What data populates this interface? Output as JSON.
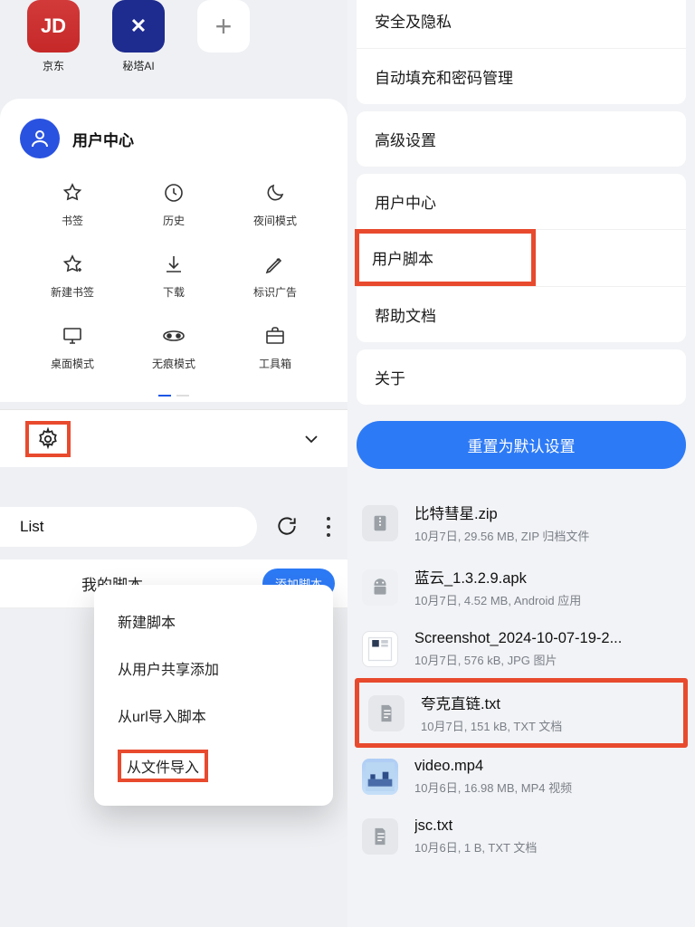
{
  "home": {
    "apps": [
      {
        "id": "jd",
        "label": "京东",
        "tile": "JD"
      },
      {
        "id": "mita",
        "label": "秘塔AI",
        "tile": "✕"
      },
      {
        "id": "plus",
        "label": "",
        "tile": "+"
      }
    ]
  },
  "user_center": {
    "title": "用户中心",
    "grid": [
      {
        "id": "bookmark",
        "label": "书签"
      },
      {
        "id": "history",
        "label": "历史"
      },
      {
        "id": "night",
        "label": "夜间模式"
      },
      {
        "id": "add-bookmark",
        "label": "新建书签"
      },
      {
        "id": "download",
        "label": "下载"
      },
      {
        "id": "mark-ad",
        "label": "标识广告"
      },
      {
        "id": "desktop",
        "label": "桌面模式"
      },
      {
        "id": "incognito",
        "label": "无痕模式"
      },
      {
        "id": "toolbox",
        "label": "工具箱"
      }
    ]
  },
  "address_bar": {
    "text": "List"
  },
  "scripts": {
    "my_scripts_label": "我的脚本",
    "add_label": "添加脚本",
    "menu": [
      {
        "id": "new",
        "label": "新建脚本"
      },
      {
        "id": "from-share",
        "label": "从用户共享添加"
      },
      {
        "id": "from-url",
        "label": "从url导入脚本"
      },
      {
        "id": "from-file",
        "label": "从文件导入"
      }
    ]
  },
  "settings": {
    "items": [
      {
        "id": "security",
        "label": "安全及隐私"
      },
      {
        "id": "autofill",
        "label": "自动填充和密码管理"
      },
      {
        "id": "advanced",
        "label": "高级设置"
      },
      {
        "id": "user-center",
        "label": "用户中心"
      },
      {
        "id": "user-script",
        "label": "用户脚本"
      },
      {
        "id": "help",
        "label": "帮助文档"
      },
      {
        "id": "about",
        "label": "关于"
      }
    ],
    "reset_label": "重置为默认设置"
  },
  "files": [
    {
      "id": "zip",
      "icon": "zip",
      "name": "比特彗星.zip",
      "meta": "10月7日, 29.56 MB, ZIP 归档文件"
    },
    {
      "id": "apk",
      "icon": "android",
      "name": "蓝云_1.3.2.9.apk",
      "meta": "10月7日, 4.52 MB, Android 应用"
    },
    {
      "id": "png",
      "icon": "image",
      "name": "Screenshot_2024-10-07-19-2...",
      "meta": "10月7日, 576 kB, JPG 图片"
    },
    {
      "id": "txt",
      "icon": "doc",
      "name": "夸克直链.txt",
      "meta": "10月7日, 151 kB, TXT 文档"
    },
    {
      "id": "mp4",
      "icon": "video",
      "name": "video.mp4",
      "meta": "10月6日, 16.98 MB, MP4 视频"
    },
    {
      "id": "txt2",
      "icon": "doc",
      "name": "jsc.txt",
      "meta": "10月6日, 1 B, TXT 文档"
    }
  ]
}
